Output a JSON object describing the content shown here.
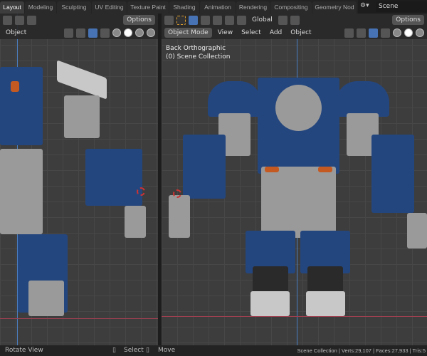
{
  "workspace_tabs": [
    "Layout",
    "Modeling",
    "Sculpting",
    "UV Editing",
    "Texture Paint",
    "Shading",
    "Animation",
    "Rendering",
    "Compositing",
    "Geometry Nod"
  ],
  "active_tab": "Layout",
  "scene": "Scene",
  "left_viewport": {
    "options": "Options",
    "mode_label": "Object"
  },
  "right_viewport": {
    "options": "Options",
    "transform": "Global",
    "mode": "Object Mode",
    "menus": [
      "View",
      "Select",
      "Add",
      "Object"
    ],
    "overlay_title": "Back Orthographic",
    "overlay_collection": "(0) Scene Collection"
  },
  "status": {
    "left": "Rotate View",
    "select": "Select",
    "move": "Move",
    "right": "Scene Collection | Verts:29,107 | Faces:27,933 | Tris:5"
  },
  "colors": {
    "accent": "#4772b3",
    "robot_blue": "#24467e"
  }
}
